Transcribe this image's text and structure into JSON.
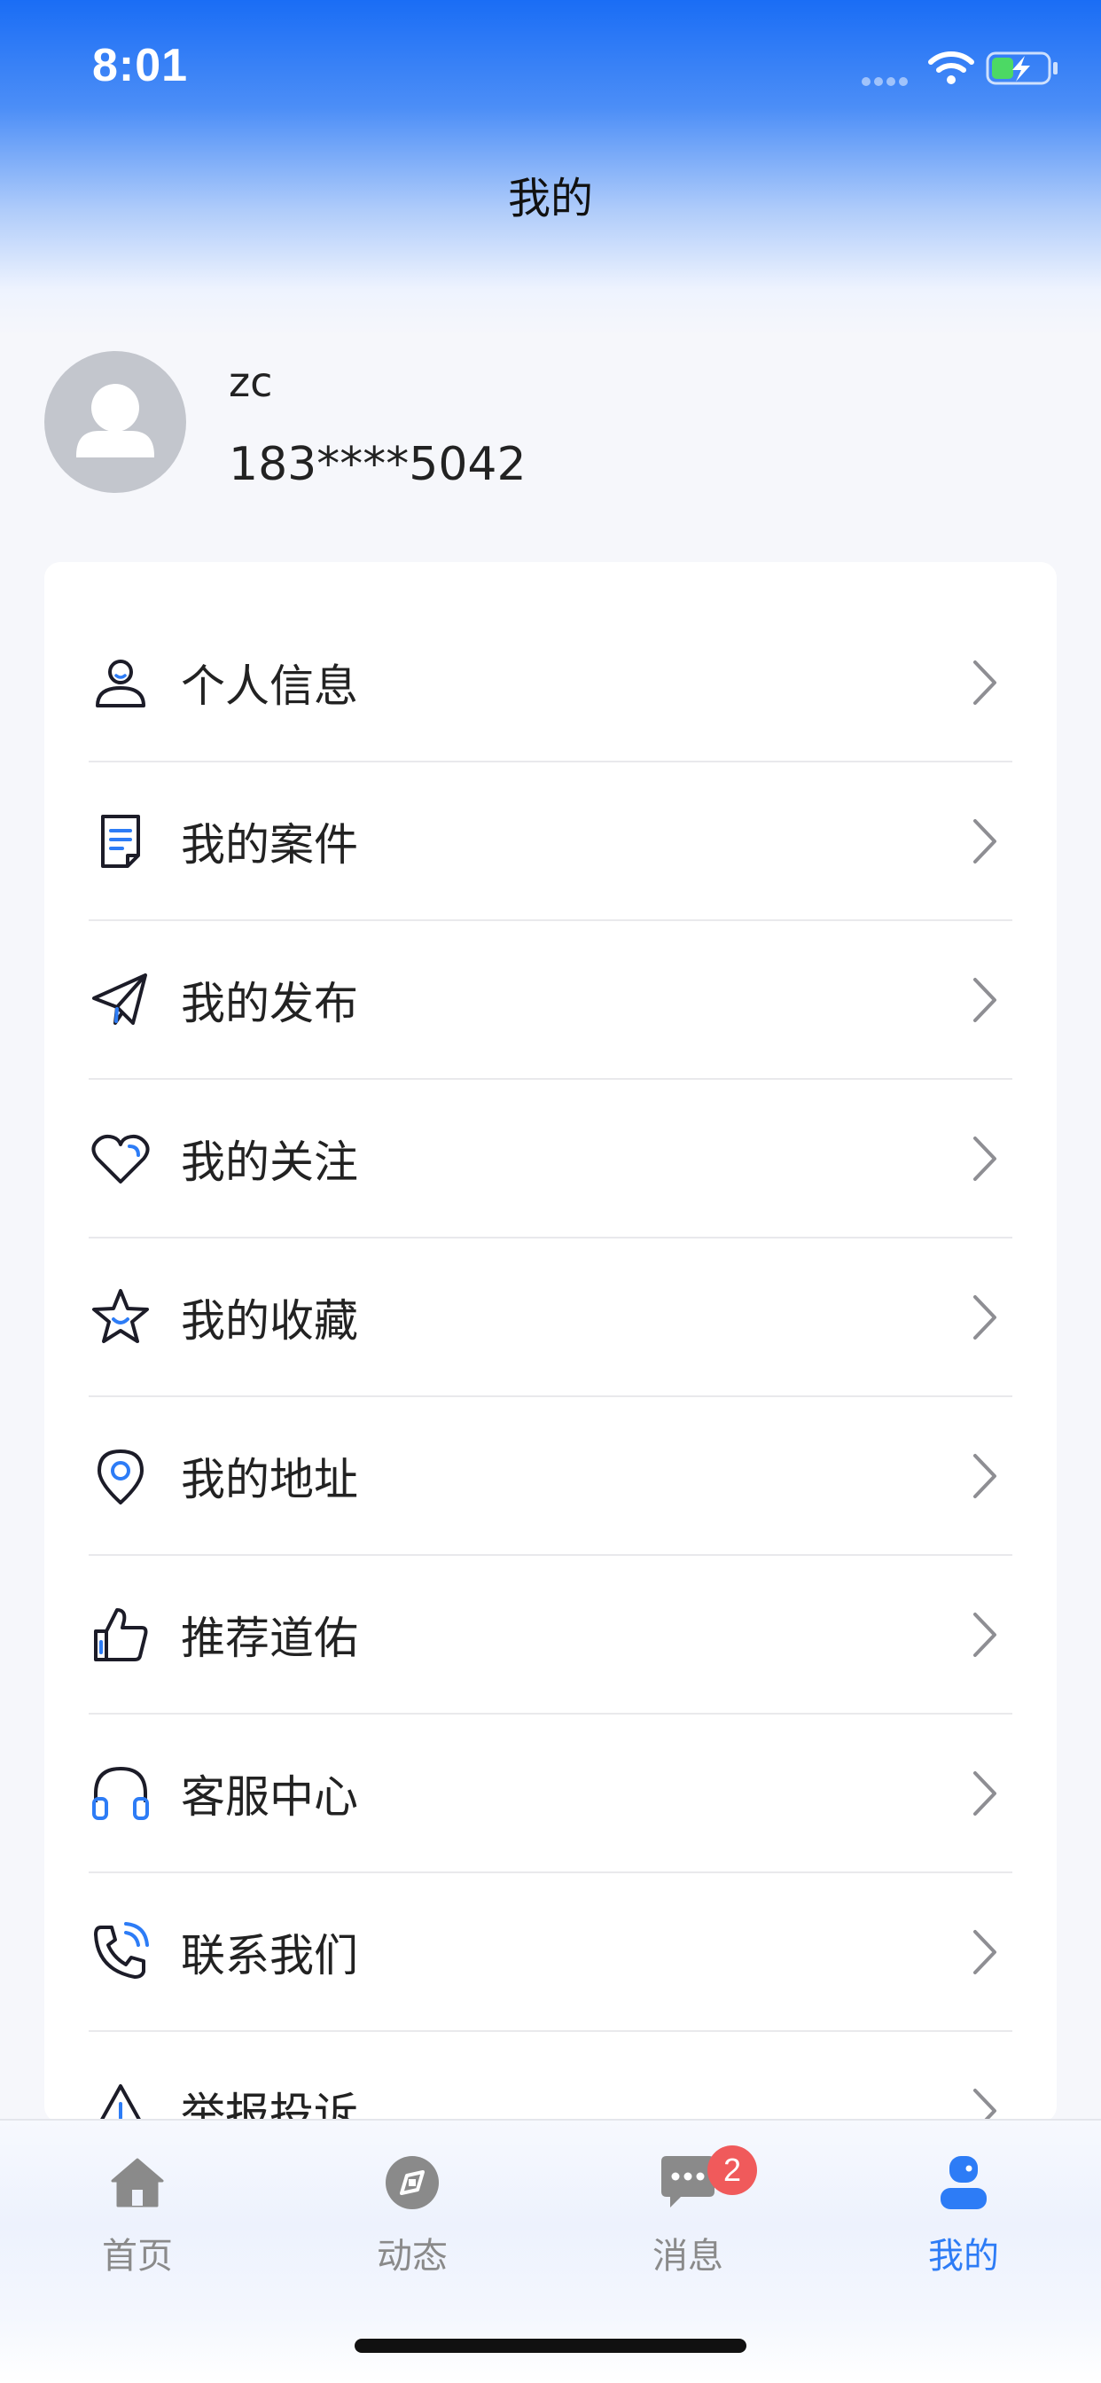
{
  "status_bar": {
    "time": "8:01"
  },
  "header": {
    "title": "我的"
  },
  "profile": {
    "name": "zc",
    "phone": "183****5042"
  },
  "menu": {
    "items": [
      {
        "label": "个人信息",
        "icon": "user-icon"
      },
      {
        "label": "我的案件",
        "icon": "document-icon"
      },
      {
        "label": "我的发布",
        "icon": "paper-plane-icon"
      },
      {
        "label": "我的关注",
        "icon": "heart-icon"
      },
      {
        "label": "我的收藏",
        "icon": "star-icon"
      },
      {
        "label": "我的地址",
        "icon": "location-pin-icon"
      },
      {
        "label": "推荐道佑",
        "icon": "thumbs-up-icon"
      },
      {
        "label": "客服中心",
        "icon": "headphones-icon"
      },
      {
        "label": "联系我们",
        "icon": "phone-icon"
      },
      {
        "label": "举报投诉",
        "icon": "warning-icon"
      }
    ]
  },
  "tabbar": {
    "tabs": [
      {
        "label": "首页",
        "icon": "home-icon"
      },
      {
        "label": "动态",
        "icon": "compass-icon"
      },
      {
        "label": "消息",
        "icon": "chat-bubble-icon",
        "badge": "2"
      },
      {
        "label": "我的",
        "icon": "profile-icon",
        "active": true
      }
    ]
  },
  "colors": {
    "accent": "#2d7cf6",
    "header_gradient_top": "#1a6df5",
    "badge": "#f05a5b",
    "icon_stroke": "#1c1c28"
  }
}
